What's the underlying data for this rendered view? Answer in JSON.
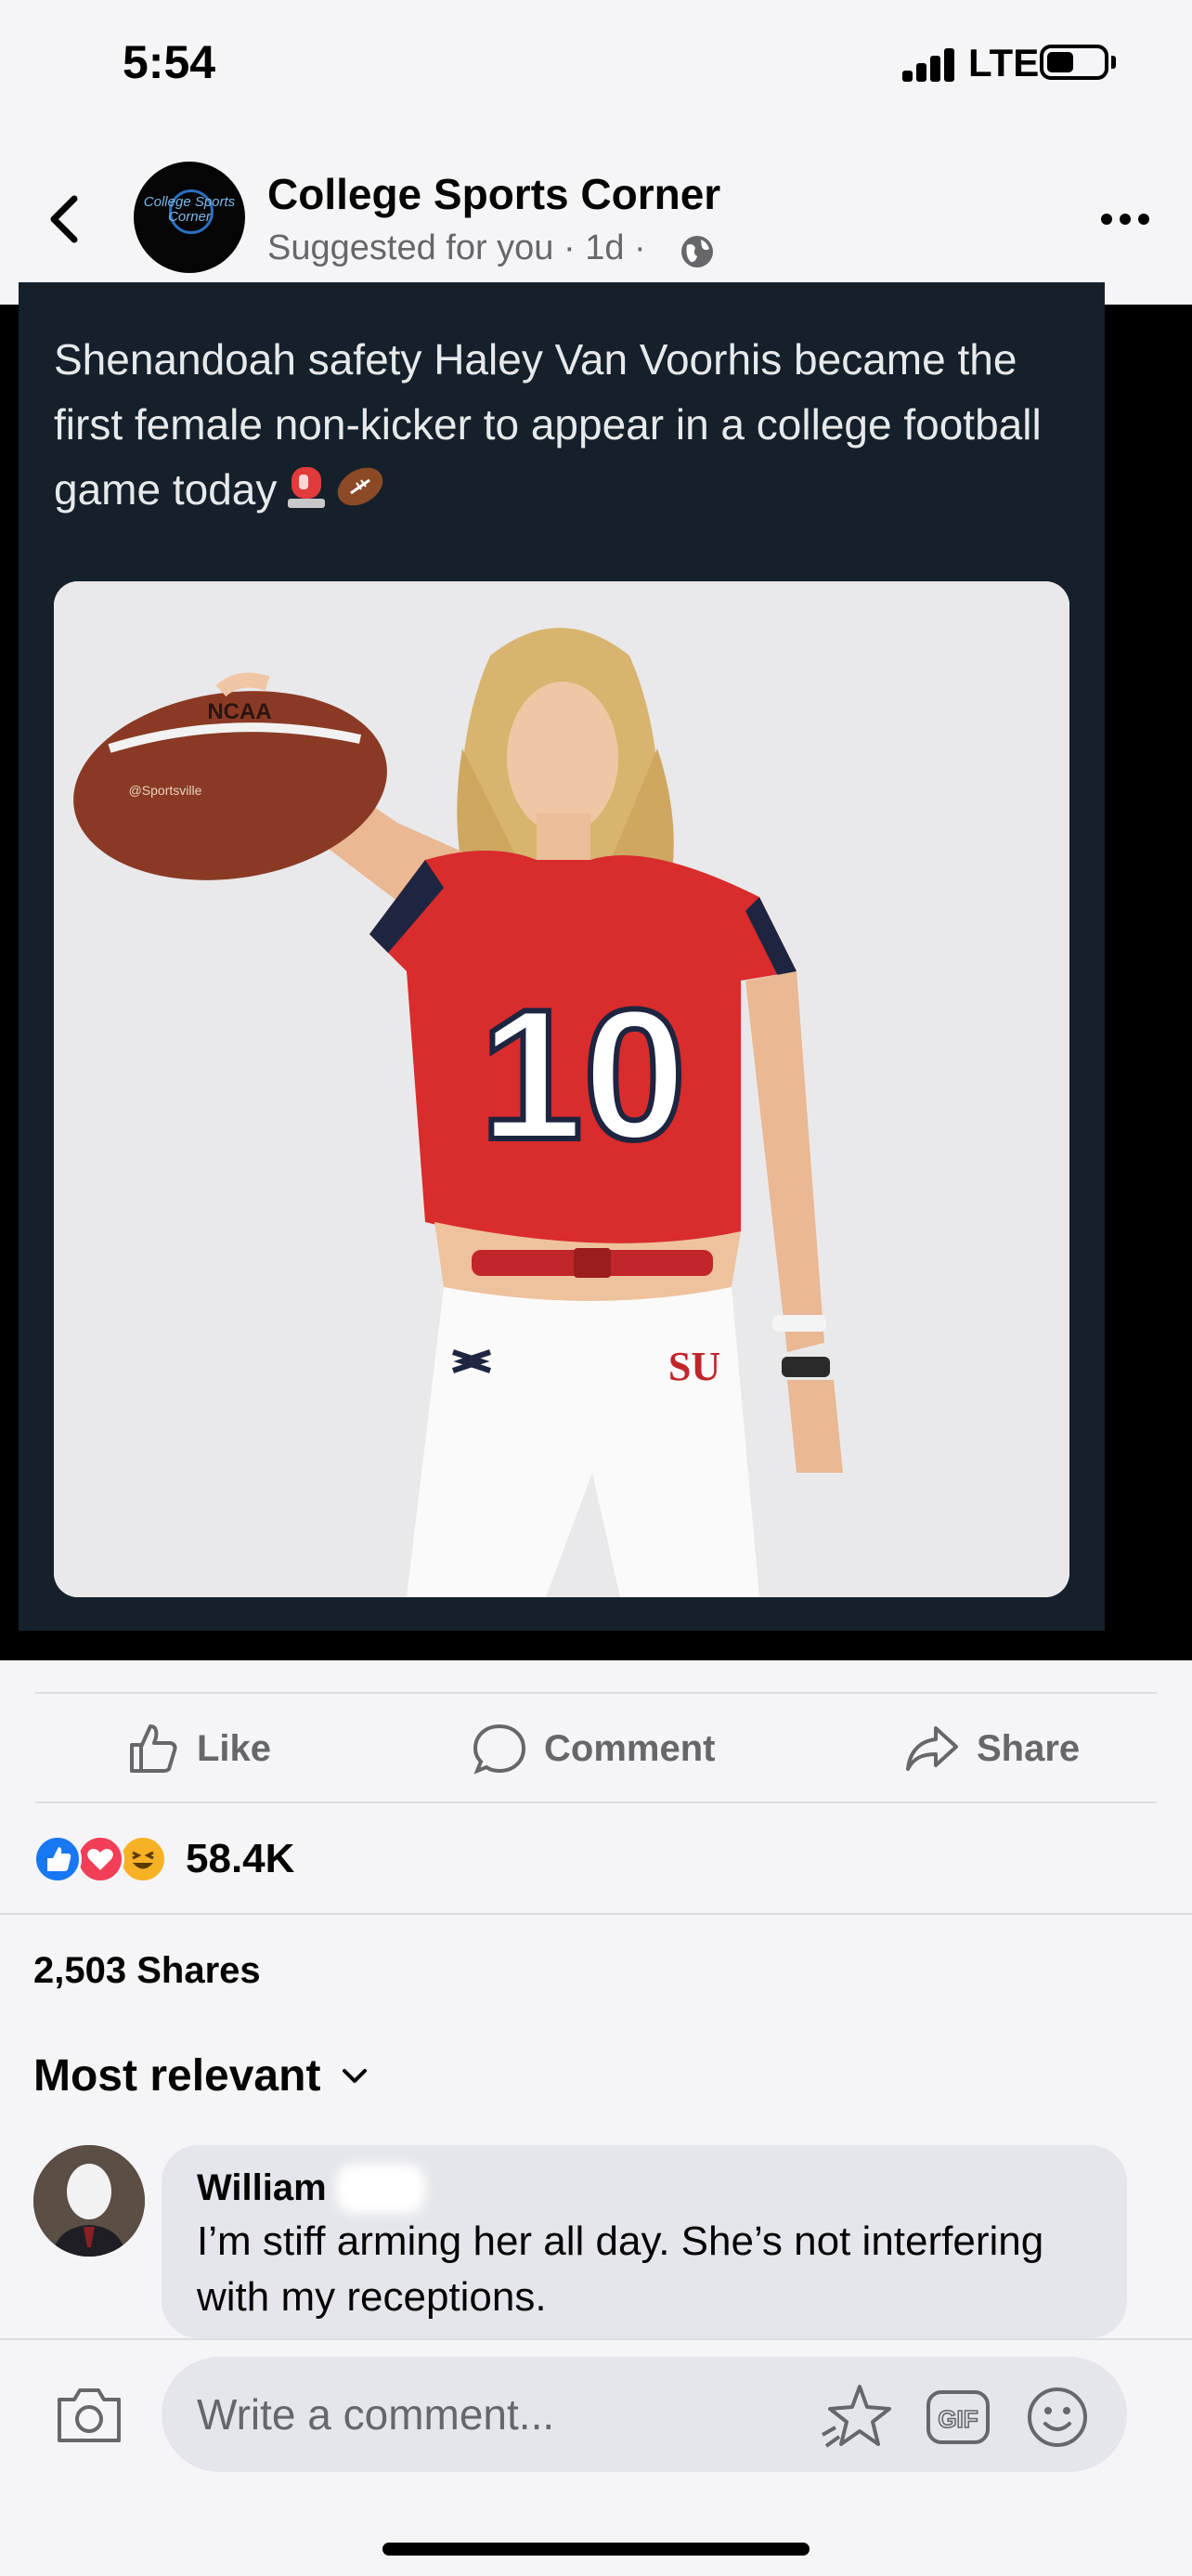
{
  "status_bar": {
    "time": "5:54",
    "network": "LTE"
  },
  "post": {
    "page_name": "College Sports Corner",
    "avatar_text": "College Sports Corner",
    "meta": "Suggested for you · 1d ·",
    "tweet_text": "Shenandoah safety Haley Van Voorhis became the first female non-kicker to appear in a college football game today",
    "jersey_number": "10",
    "ball_text": "NCAA",
    "ball_brand": "@Sportsville",
    "pants_logo": "SU"
  },
  "actions": {
    "like": "Like",
    "comment": "Comment",
    "share": "Share"
  },
  "engagement": {
    "reactions_count": "58.4K",
    "shares": "2,503 Shares"
  },
  "comments": {
    "sort_label": "Most relevant",
    "items": [
      {
        "author": "William",
        "text": "I’m stiff arming her all day. She’s not interfering with my receptions."
      }
    ]
  },
  "composer": {
    "placeholder": "Write a comment..."
  },
  "colors": {
    "dark_card": "#15202b",
    "like_blue": "#1877f2",
    "love_red": "#f33e58",
    "haha_yellow": "#f7b125",
    "muted": "#65676b"
  }
}
